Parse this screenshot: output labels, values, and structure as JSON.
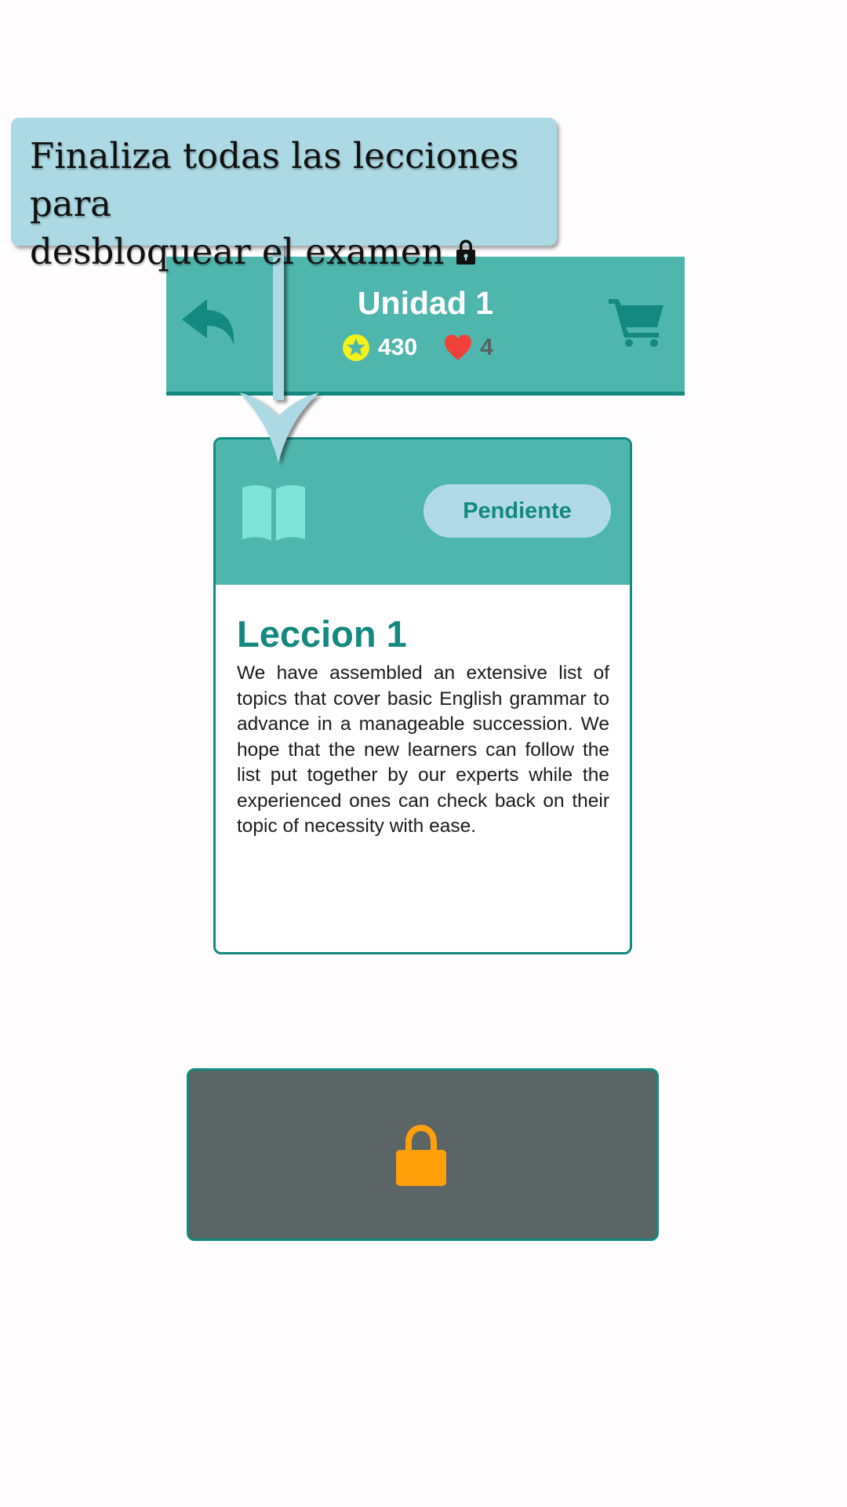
{
  "header": {
    "title": "Unidad 1",
    "coins": "430",
    "lives": "4",
    "back_icon": "reply-arrow-icon",
    "cart_icon": "shopping-cart-icon",
    "coin_icon": "star-coin-icon",
    "heart_icon": "heart-icon"
  },
  "lesson_card": {
    "status": "Pendiente",
    "title": "Leccion 1",
    "description": "We have assembled an extensive list of topics that cover basic English grammar to advance in a manageable succession. We hope that the new learners can follow the list put together by our experts while the experienced ones can check back on their topic of necessity with ease.",
    "icon": "open-book-icon"
  },
  "exam_button": {
    "icon": "lock-icon",
    "locked": true
  },
  "tutorial_tooltip": {
    "line1": "Finaliza todas las lecciones para",
    "line2": "desbloquear el examen",
    "icon": "lock-icon"
  },
  "colors": {
    "teal": "#4fb6ad",
    "dark_teal": "#13897f",
    "badge_bg": "#b0dbe6",
    "book_icon": "#7fe3d8",
    "coin_yellow": "#f3f01a",
    "heart_red": "#ef4137",
    "lock_orange": "#ff9f0a",
    "exam_bg": "#5c6566",
    "tooltip_bg": "#acd9e3"
  }
}
